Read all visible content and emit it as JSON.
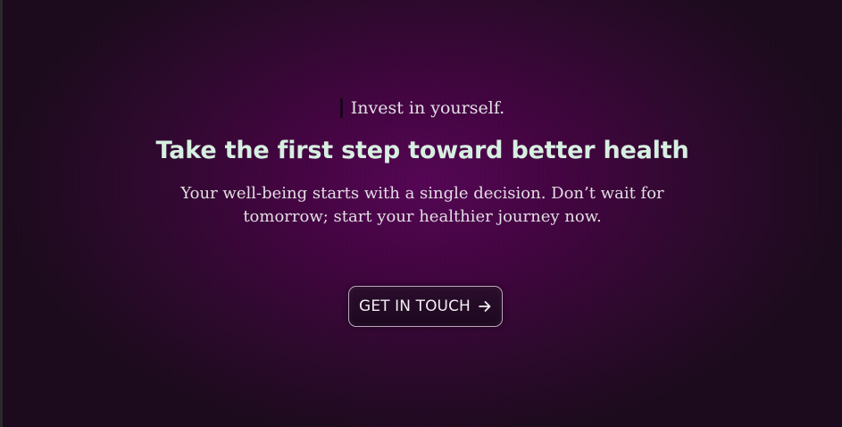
{
  "hero": {
    "eyebrow": "Invest in yourself.",
    "headline": "Take the first step toward better health",
    "description": "Your well-being starts with a single decision. Don’t wait for tomorrow; start your healthier journey now.",
    "cta": {
      "label": "GET IN TOUCH",
      "icon": "arrow-right-icon"
    }
  },
  "colors": {
    "background_center": "#560655",
    "background_edge": "#1b0b1c",
    "headline": "#d7efe1",
    "body_text": "#e2dde4",
    "button_border": "#b9a8bd"
  }
}
